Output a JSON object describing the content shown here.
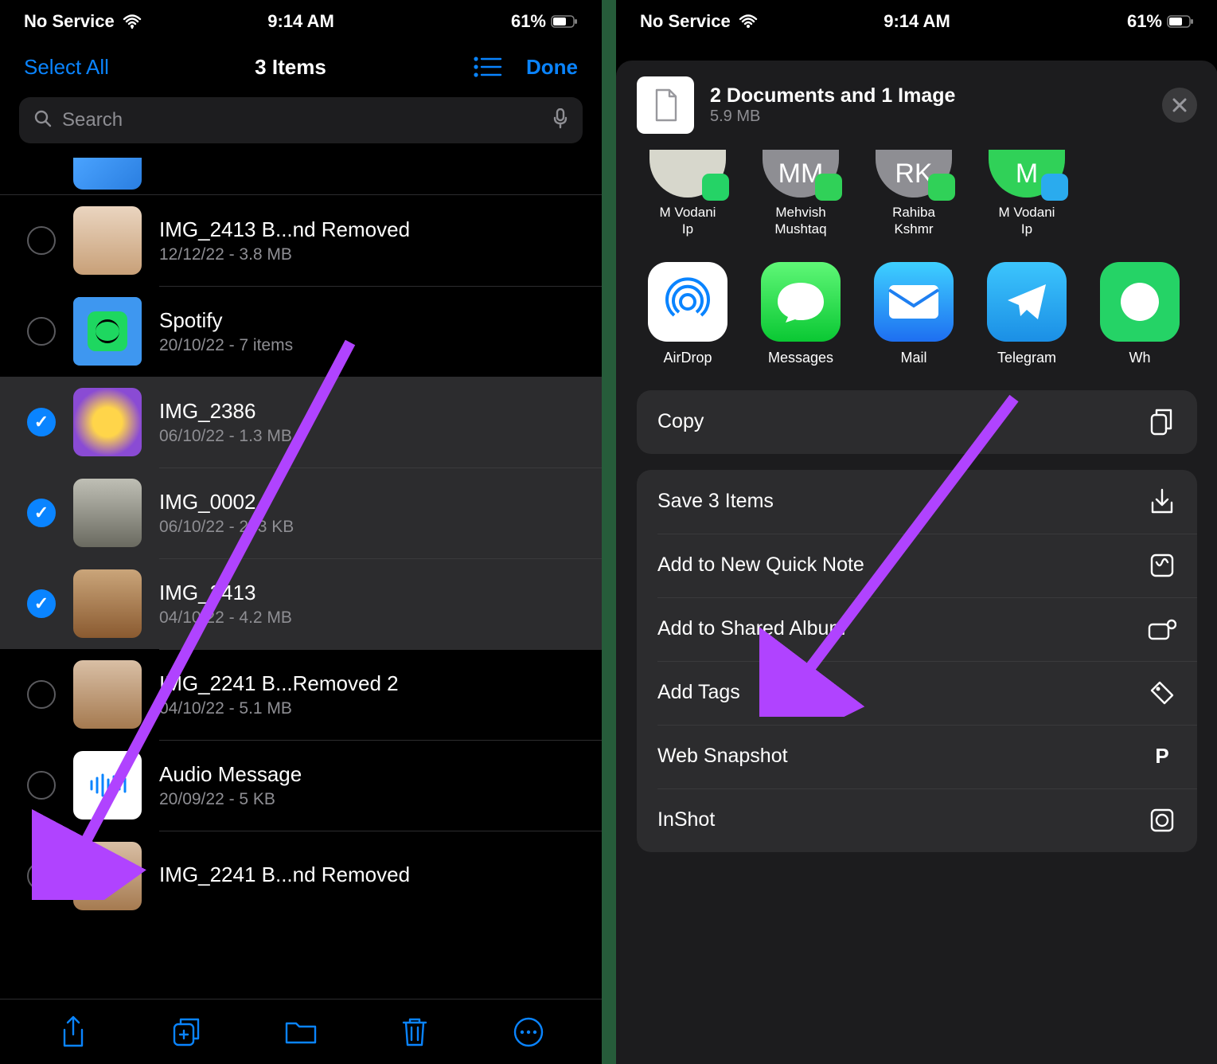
{
  "left": {
    "status": {
      "carrier": "No Service",
      "time": "9:14 AM",
      "battery": "61%"
    },
    "nav": {
      "selectAll": "Select All",
      "title": "3 Items",
      "done": "Done"
    },
    "search": {
      "placeholder": "Search"
    },
    "files": [
      {
        "name": "IMG_2413 B...nd Removed",
        "meta": "12/12/22 - 3.8 MB",
        "selected": false,
        "thumb": "rope"
      },
      {
        "name": "Spotify",
        "meta": "20/10/22 - 7 items",
        "selected": false,
        "thumb": "spotify-folder"
      },
      {
        "name": "IMG_2386",
        "meta": "06/10/22 - 1.3 MB",
        "selected": true,
        "thumb": "habits"
      },
      {
        "name": "IMG_0002",
        "meta": "06/10/22 - 273 KB",
        "selected": true,
        "thumb": "legs"
      },
      {
        "name": "IMG_2413",
        "meta": "04/10/22 - 4.2 MB",
        "selected": true,
        "thumb": "croc"
      },
      {
        "name": "IMG_2241 B...Removed 2",
        "meta": "04/10/22 - 5.1 MB",
        "selected": false,
        "thumb": "bag"
      },
      {
        "name": "Audio Message",
        "meta": "20/09/22 - 5 KB",
        "selected": false,
        "thumb": "audio"
      },
      {
        "name": "IMG_2241 B...nd Removed",
        "meta": "",
        "selected": false,
        "thumb": "bag2"
      }
    ]
  },
  "right": {
    "status": {
      "carrier": "No Service",
      "time": "9:14 AM",
      "battery": "61%"
    },
    "share": {
      "title": "2 Documents and 1 Image",
      "sub": "5.9 MB"
    },
    "contacts": [
      {
        "name": "M Vodani Ip",
        "initials": "",
        "badge": "whatsapp",
        "color": "#d7d7cc"
      },
      {
        "name": "Mehvish Mushtaq",
        "initials": "MM",
        "badge": "imsg",
        "color": "#8e8e93"
      },
      {
        "name": "Rahiba Kshmr",
        "initials": "RK",
        "badge": "imsg",
        "color": "#8e8e93"
      },
      {
        "name": "M Vodani Ip",
        "initials": "M",
        "badge": "telegram",
        "color": "#30d158"
      }
    ],
    "apps": [
      {
        "name": "AirDrop",
        "kind": "airdrop"
      },
      {
        "name": "Messages",
        "kind": "messages"
      },
      {
        "name": "Mail",
        "kind": "mail"
      },
      {
        "name": "Telegram",
        "kind": "telegram"
      },
      {
        "name": "Wh",
        "kind": "whatsapp"
      }
    ],
    "copy": {
      "label": "Copy"
    },
    "actions": [
      {
        "label": "Save 3 Items",
        "icon": "download"
      },
      {
        "label": "Add to New Quick Note",
        "icon": "note"
      },
      {
        "label": "Add to Shared Album",
        "icon": "album"
      },
      {
        "label": "Add Tags",
        "icon": "tag"
      },
      {
        "label": "Web Snapshot",
        "icon": "p"
      },
      {
        "label": "InShot",
        "icon": "inshot"
      }
    ]
  }
}
